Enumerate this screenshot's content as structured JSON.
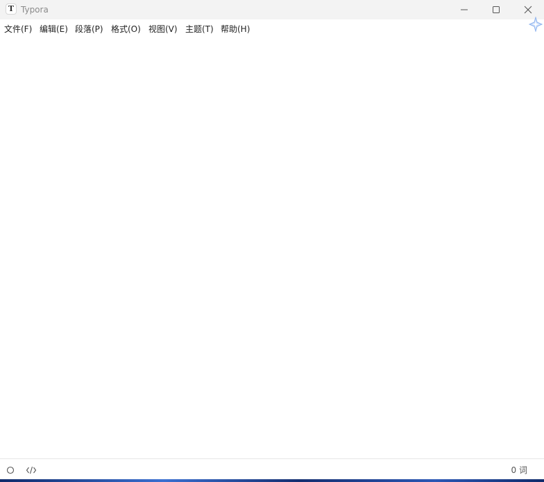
{
  "titlebar": {
    "app_icon_letter": "T",
    "title": "Typora",
    "controls": [
      "minimize-icon",
      "maximize-icon",
      "close-icon"
    ]
  },
  "menubar": {
    "items": [
      {
        "label": "文件(F)"
      },
      {
        "label": "编辑(E)"
      },
      {
        "label": "段落(P)"
      },
      {
        "label": "格式(O)"
      },
      {
        "label": "视图(V)"
      },
      {
        "label": "主题(T)"
      },
      {
        "label": "帮助(H)"
      }
    ]
  },
  "statusbar": {
    "outline_icon": "circle-outline-icon",
    "source_icon": "code-brackets-icon",
    "word_count": "0 词"
  }
}
